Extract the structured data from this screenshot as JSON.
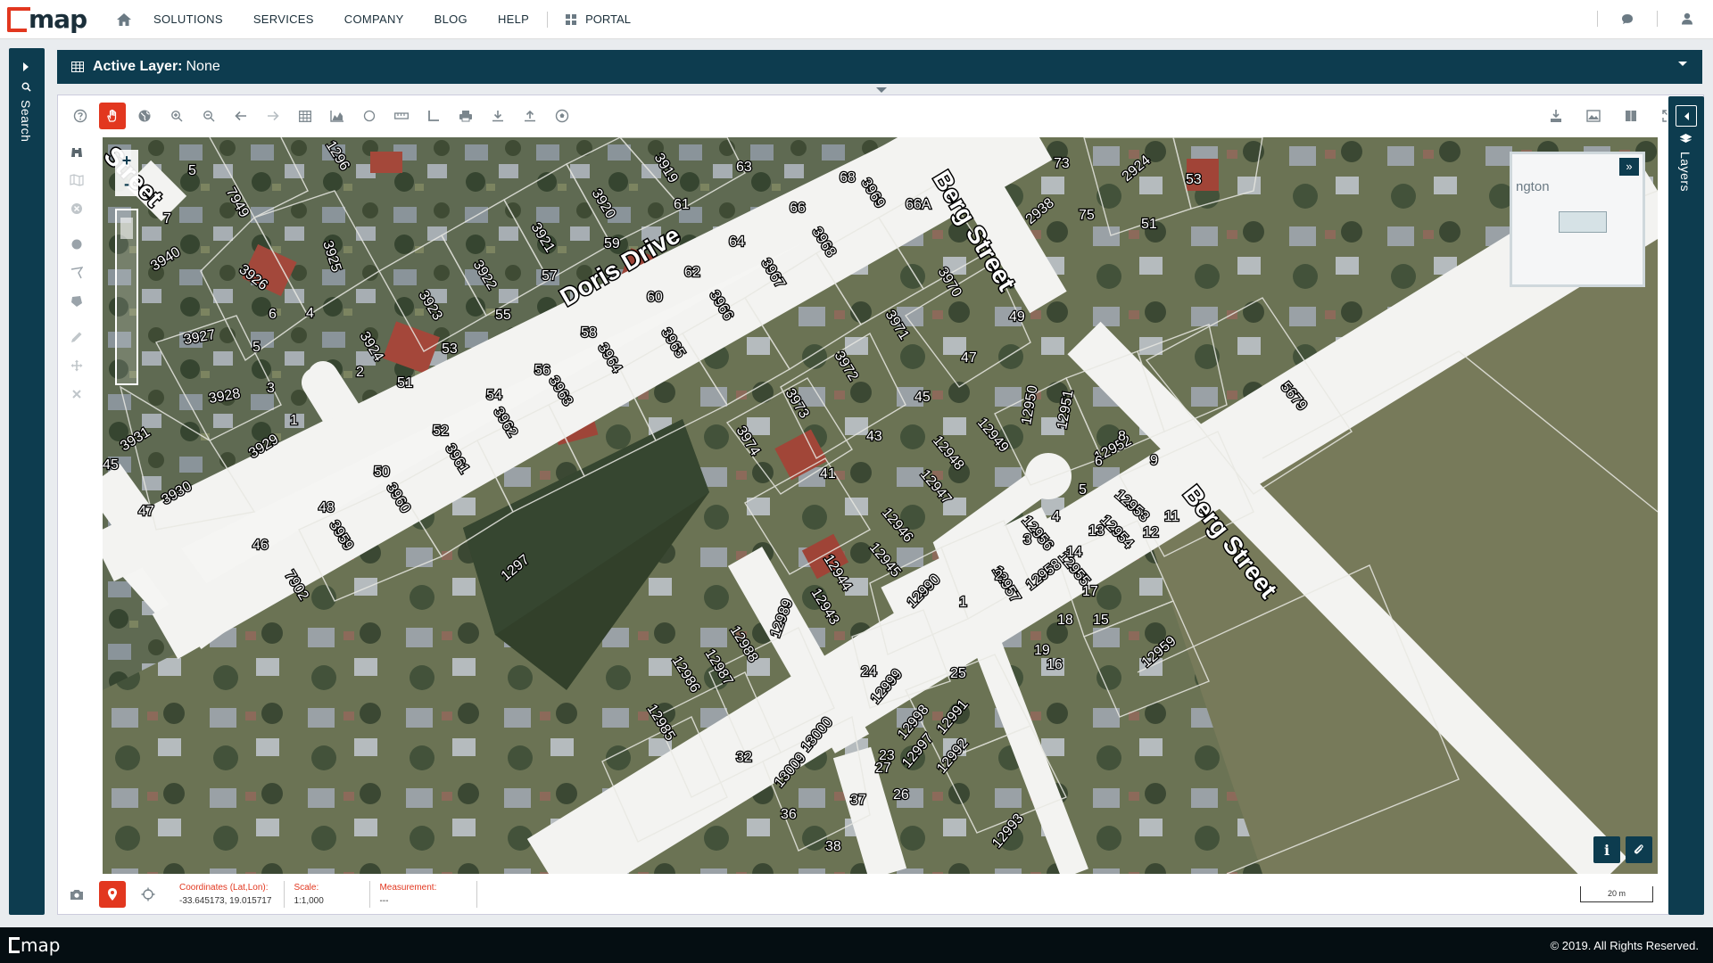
{
  "brand": {
    "logo_text": "map"
  },
  "nav": {
    "items": [
      "SOLUTIONS",
      "SERVICES",
      "COMPANY",
      "BLOG",
      "HELP"
    ],
    "portal": "PORTAL"
  },
  "left_panel": {
    "label": "Search"
  },
  "right_panel": {
    "label": "Layers"
  },
  "layer_bar": {
    "label": "Active Layer:",
    "value": "None"
  },
  "map": {
    "streets": [
      "Doris Drive",
      "Berg Street",
      "Berg Street",
      "Street"
    ],
    "parcels": [
      "7949",
      "3926",
      "3925",
      "3940",
      "3927",
      "3928",
      "3929",
      "3931",
      "3930",
      "3921",
      "3920",
      "3919",
      "3922",
      "3923",
      "3924",
      "3966",
      "3965",
      "3964",
      "3963",
      "3962",
      "3961",
      "3960",
      "3959",
      "3967",
      "3968",
      "3969",
      "3970",
      "3971",
      "3972",
      "3973",
      "3974",
      "7902",
      "1297",
      "12950",
      "12951",
      "12949",
      "12948",
      "12952",
      "12947",
      "12953",
      "12946",
      "12956",
      "12945",
      "12944",
      "12955",
      "12954",
      "12943",
      "12957",
      "12958",
      "12959",
      "12990",
      "12988",
      "12987",
      "12989",
      "12986",
      "12985",
      "12999",
      "12998",
      "12991",
      "12992",
      "12997",
      "13000",
      "13009",
      "12993",
      "2924",
      "2938",
      "5679",
      "1296"
    ],
    "numbers": [
      "5",
      "7",
      "6",
      "4",
      "5",
      "3",
      "1",
      "45",
      "47",
      "2",
      "51",
      "53",
      "55",
      "57",
      "59",
      "61",
      "63",
      "68",
      "66",
      "66A",
      "64",
      "62",
      "60",
      "58",
      "56",
      "54",
      "52",
      "50",
      "48",
      "46",
      "49",
      "47",
      "45",
      "43",
      "41",
      "73",
      "75",
      "51",
      "53",
      "8",
      "6",
      "9",
      "5",
      "4",
      "3",
      "2",
      "1",
      "14",
      "13",
      "12",
      "11",
      "15",
      "16",
      "17",
      "18",
      "19",
      "25",
      "24",
      "23",
      "26",
      "27",
      "37",
      "38",
      "36",
      "32"
    ],
    "minimap_text": "ngton",
    "zoom_in": "+",
    "zoom_out": "-"
  },
  "status": {
    "coords_label": "Coordinates (Lat,Lon):",
    "coords_value": "-33.645173, 19.015717",
    "scale_label": "Scale:",
    "scale_value": "1:1,000",
    "measure_label": "Measurement:",
    "measure_value": "---",
    "scalebar": "20 m"
  },
  "footer": {
    "logo_text": "map",
    "copyright": "© 2019. All Rights Reserved."
  },
  "colors": {
    "brand_red": "#e2371f",
    "panel": "#0d3c4f",
    "footer": "#050e12"
  }
}
